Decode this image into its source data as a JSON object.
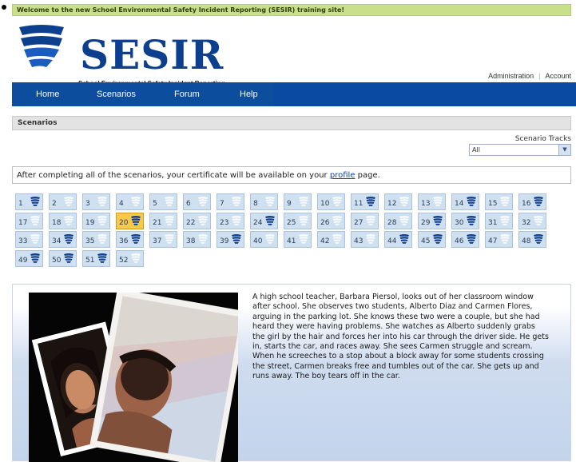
{
  "banner": {
    "welcome": "Welcome to the new School Environmental Safety Incident Reporting (SESIR) training site!"
  },
  "logo": {
    "title": "SESIR",
    "subtitle": "School Environmental Safety Incident Reporting"
  },
  "top_links": {
    "admin": "Administration",
    "account": "Account"
  },
  "nav": {
    "items": [
      "Home",
      "Scenarios",
      "Forum",
      "Help"
    ]
  },
  "page": {
    "section_title": "Scenarios"
  },
  "tracks": {
    "label": "Scenario Tracks",
    "selected": "All"
  },
  "notice": {
    "before": "After completing all of the scenarios, your certificate will be available on your ",
    "link": "profile",
    "after": " page."
  },
  "scenarios": {
    "numbers": [
      1,
      2,
      3,
      4,
      5,
      6,
      7,
      8,
      9,
      10,
      11,
      12,
      13,
      14,
      15,
      16,
      17,
      18,
      19,
      20,
      21,
      22,
      23,
      24,
      25,
      26,
      27,
      28,
      29,
      30,
      31,
      32,
      33,
      34,
      35,
      36,
      37,
      38,
      39,
      40,
      41,
      42,
      43,
      44,
      45,
      46,
      47,
      48,
      49,
      50,
      51,
      52
    ],
    "completed": [
      1,
      11,
      14,
      16,
      20,
      24,
      29,
      30,
      34,
      36,
      39,
      44,
      45,
      46,
      48,
      49,
      50,
      51
    ],
    "current": 20
  },
  "story": {
    "text": "A high school teacher, Barbara Piersol, looks out of her classroom window after school.  She observes two students, Alberto Diaz and Carmen Flores, arguing in the parking lot.  She knows these two were a couple, but she had heard they were having problems.  She watches as Alberto suddenly grabs the girl by the hair and forces her into his car through the driver side.  He gets in, starts the car, and races away.  She sees Carmen struggle and scream.  When he screeches to a stop about a block away for some students crossing the street, Carmen breaks free and tumbles out of the car.  She gets up and runs away.  The boy tears off in the car."
  },
  "colors": {
    "brand": "#0d3f8f",
    "nav": "#0a4aa3",
    "active_tile": "#f6c84d",
    "tile": "#cfe0f1"
  }
}
